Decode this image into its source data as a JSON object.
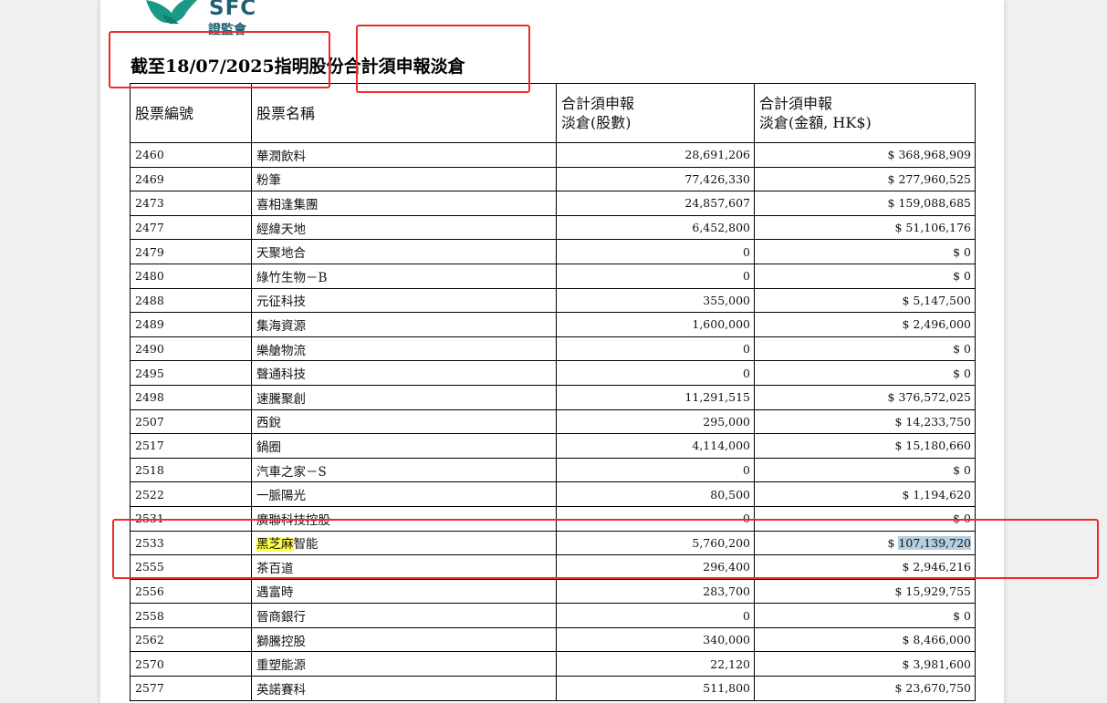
{
  "logo": {
    "text": "SFC",
    "chinese": "證監會",
    "icon": "eagle-logo-icon"
  },
  "title": "截至18/07/2025指明股份合計須申報淡倉",
  "columns": {
    "code": "股票編號",
    "name": "股票名稱",
    "shares_line1": "合計須申報",
    "shares_line2": "淡倉(股數)",
    "amount_line1": "合計須申報",
    "amount_line2": "淡倉(金額, HK$)"
  },
  "rows": [
    {
      "code": "2460",
      "name": "華潤飲料",
      "shares": "28,691,206",
      "amount": "$ 368,968,909"
    },
    {
      "code": "2469",
      "name": "粉筆",
      "shares": "77,426,330",
      "amount": "$ 277,960,525"
    },
    {
      "code": "2473",
      "name": "喜相逢集團",
      "shares": "24,857,607",
      "amount": "$ 159,088,685"
    },
    {
      "code": "2477",
      "name": "經緯天地",
      "shares": "6,452,800",
      "amount": "$ 51,106,176"
    },
    {
      "code": "2479",
      "name": "天聚地合",
      "shares": "0",
      "amount": "$ 0"
    },
    {
      "code": "2480",
      "name": "綠竹生物－B",
      "shares": "0",
      "amount": "$ 0"
    },
    {
      "code": "2488",
      "name": "元征科技",
      "shares": "355,000",
      "amount": "$ 5,147,500"
    },
    {
      "code": "2489",
      "name": "集海資源",
      "shares": "1,600,000",
      "amount": "$ 2,496,000"
    },
    {
      "code": "2490",
      "name": "樂艙物流",
      "shares": "0",
      "amount": "$ 0"
    },
    {
      "code": "2495",
      "name": "聲通科技",
      "shares": "0",
      "amount": "$ 0"
    },
    {
      "code": "2498",
      "name": "速騰聚創",
      "shares": "11,291,515",
      "amount": "$ 376,572,025"
    },
    {
      "code": "2507",
      "name": "西銳",
      "shares": "295,000",
      "amount": "$ 14,233,750"
    },
    {
      "code": "2517",
      "name": "鍋圈",
      "shares": "4,114,000",
      "amount": "$ 15,180,660"
    },
    {
      "code": "2518",
      "name": "汽車之家－S",
      "shares": "0",
      "amount": "$ 0"
    },
    {
      "code": "2522",
      "name": "一脈陽光",
      "shares": "80,500",
      "amount": "$ 1,194,620"
    },
    {
      "code": "2531",
      "name": "廣聯科技控股",
      "shares": "0",
      "amount": "$ 0"
    },
    {
      "code": "2533",
      "name_highlight": "黑芝麻",
      "name_rest": "智能",
      "shares": "5,760,200",
      "amount_prefix": "$ ",
      "amount_highlight": "107,139,720"
    },
    {
      "code": "2555",
      "name": "茶百道",
      "shares": "296,400",
      "amount": "$ 2,946,216"
    },
    {
      "code": "2556",
      "name": "遇富時",
      "shares": "283,700",
      "amount": "$ 15,929,755"
    },
    {
      "code": "2558",
      "name": "晉商銀行",
      "shares": "0",
      "amount": "$ 0"
    },
    {
      "code": "2562",
      "name": "獅騰控股",
      "shares": "340,000",
      "amount": "$ 8,466,000"
    },
    {
      "code": "2570",
      "name": "重塑能源",
      "shares": "22,120",
      "amount": "$ 3,981,600"
    },
    {
      "code": "2577",
      "name": "英諾賽科",
      "shares": "511,800",
      "amount": "$ 23,670,750"
    }
  ],
  "colors": {
    "annotation_red": "#ee2a2a",
    "highlight_yellow": "#ffff4d",
    "highlight_blue": "#b3cfe0",
    "logo_teal": "#1f5f72"
  }
}
